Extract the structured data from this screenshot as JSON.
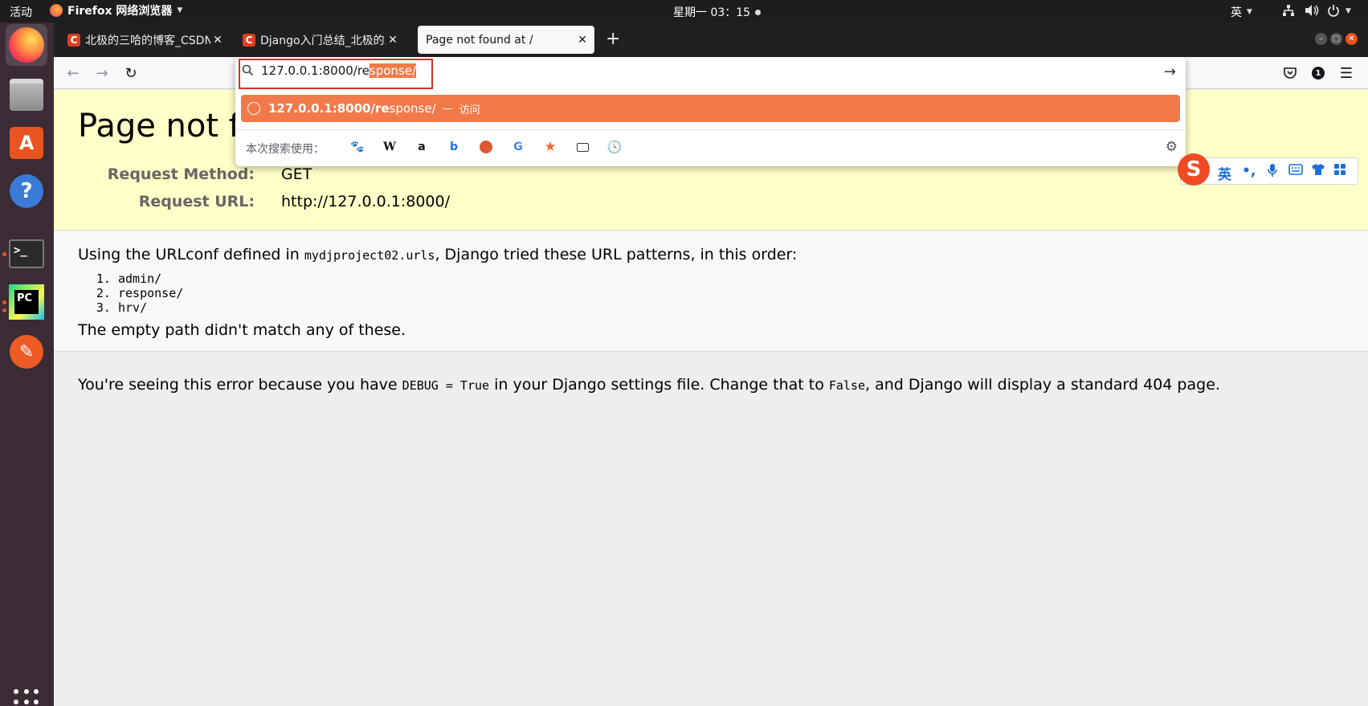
{
  "topbar": {
    "activities": "活动",
    "app_name": "Firefox 网络浏览器",
    "clock": "星期一 03：15",
    "ime_indicator": "英"
  },
  "dock": {
    "items": [
      "firefox",
      "files",
      "software-center",
      "help",
      "terminal",
      "pycharm",
      "postman"
    ]
  },
  "browser": {
    "tabs": [
      {
        "favicon": "C",
        "title": "北极的三哈的博客_CSDN博客",
        "selected": false
      },
      {
        "favicon": "C",
        "title": "Django入门总结_北极的三哈",
        "selected": false
      },
      {
        "favicon": "",
        "title": "Page not found at /",
        "selected": true
      }
    ],
    "new_tab": "+",
    "toolbar_badge": "1"
  },
  "urlbar": {
    "typed": "127.0.0.1:8000/re",
    "autofill": "sponse/",
    "suggestion_bold": "127.0.0.1:8000/re",
    "suggestion_rest": "sponse/",
    "suggestion_separator": "—",
    "suggestion_action": "访问",
    "search_label": "本次搜索使用：",
    "engines": [
      "baidu-icon",
      "wikipedia-icon",
      "amazon-icon",
      "bing-icon",
      "duckduckgo-icon",
      "google-icon",
      "bookmarks-icon",
      "tabs-icon",
      "history-icon"
    ]
  },
  "page": {
    "heading": "Page not found",
    "request_method_label": "Request Method:",
    "request_method": "GET",
    "request_url_label": "Request URL:",
    "request_url": "http://127.0.0.1:8000/",
    "urlconf_prefix": "Using the URLconf defined in ",
    "urlconf_module": "mydjproject02.urls",
    "urlconf_suffix": ", Django tried these URL patterns, in this order:",
    "patterns": [
      "admin/",
      "response/",
      "hrv/"
    ],
    "no_match": "The empty path didn't match any of these.",
    "explain_prefix": "You're seeing this error because you have ",
    "explain_code1": "DEBUG = True",
    "explain_mid": " in your Django settings file. Change that to ",
    "explain_code2": "False",
    "explain_suffix": ", and Django will display a standard 404 page."
  },
  "ime": {
    "logo": "S",
    "mode": "英",
    "punct": "•,",
    "buttons": [
      "microphone-icon",
      "keyboard-icon",
      "skin-icon",
      "toolbox-icon"
    ]
  },
  "colors": {
    "accent": "#f27a4a",
    "ubuntu_orange": "#e95420",
    "django_yellow": "#ffffc8"
  }
}
